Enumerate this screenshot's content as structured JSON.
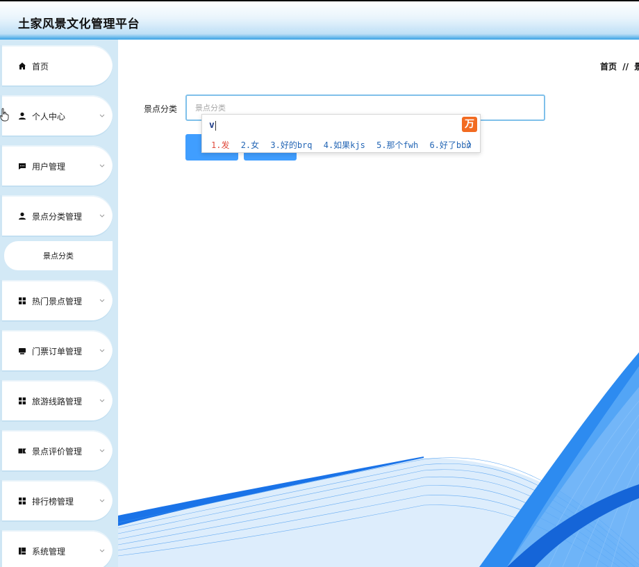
{
  "header": {
    "title": "土家风景文化管理平台"
  },
  "sidebar": {
    "items": [
      {
        "label": "首页",
        "icon": "home-icon",
        "chevron": false
      },
      {
        "label": "个人中心",
        "icon": "person-icon",
        "chevron": true
      },
      {
        "label": "用户管理",
        "icon": "chat-icon",
        "chevron": true
      },
      {
        "label": "景点分类管理",
        "icon": "person-icon",
        "chevron": true
      },
      {
        "label": "热门景点管理",
        "icon": "grid-icon",
        "chevron": true
      },
      {
        "label": "门票订单管理",
        "icon": "ticket-icon",
        "chevron": true
      },
      {
        "label": "旅游线路管理",
        "icon": "grid-icon",
        "chevron": true
      },
      {
        "label": "景点评价管理",
        "icon": "rating-icon",
        "chevron": true
      },
      {
        "label": "排行榜管理",
        "icon": "grid-icon",
        "chevron": true
      },
      {
        "label": "系统管理",
        "icon": "system-icon",
        "chevron": true
      }
    ],
    "sub_item": {
      "label": "景点分类"
    }
  },
  "breadcrumb": {
    "home": "首页",
    "separator": "//",
    "current": "景"
  },
  "form": {
    "label": "景点分类",
    "placeholder": "景点分类"
  },
  "ime": {
    "composition": "v",
    "logo": "万",
    "candidates": [
      "1.发",
      "2.女",
      "3.好的brq",
      "4.如果kjs",
      "5.那个fwh",
      "6.好了bbn"
    ],
    "prev": "〈",
    "next": "〉"
  },
  "colors": {
    "accent": "#409eff",
    "sidebar_bg": "#d3e9f6",
    "header_bottom": "#3aa2e4",
    "ime_first": "#e04a3c",
    "ime_candidate": "#2466b5"
  }
}
